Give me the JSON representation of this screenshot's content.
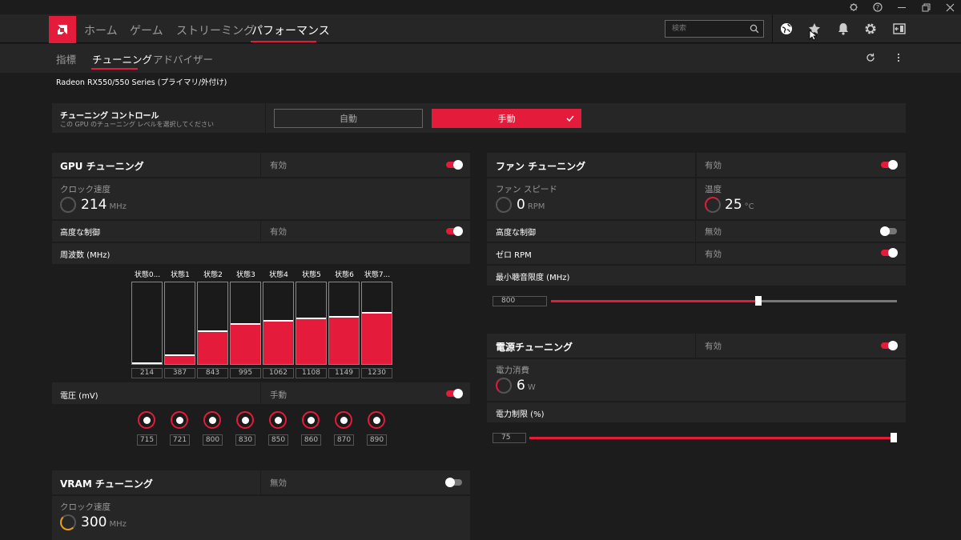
{
  "nav": {
    "items": [
      "ホーム",
      "ゲーム",
      "ストリーミング",
      "パフォーマンス"
    ],
    "active_index": 3
  },
  "search": {
    "placeholder": "検索"
  },
  "subnav": {
    "items": [
      "指標",
      "チューニング",
      "アドバイザー"
    ],
    "active_index": 1
  },
  "gpu_name": "Radeon RX550/550 Series (プライマリ/外付け)",
  "tuning_control": {
    "title": "チューニング コントロール",
    "subtitle": "この GPU のチューニング レベルを選択してください",
    "auto_label": "自動",
    "manual_label": "手動",
    "manual_selected": true
  },
  "gpu_tuning": {
    "title": "GPU チューニング",
    "status": "有効",
    "enabled": true,
    "clock": {
      "label": "クロック速度",
      "value": "214",
      "unit": "MHz"
    },
    "advanced": {
      "label": "高度な制御",
      "status": "有効",
      "enabled": true
    },
    "freq": {
      "label": "周波数 (MHz)",
      "states": [
        {
          "label": "状態0...",
          "value": "214",
          "fill": 0.02
        },
        {
          "label": "状態1",
          "value": "387",
          "fill": 0.12
        },
        {
          "label": "状態2",
          "value": "843",
          "fill": 0.41
        },
        {
          "label": "状態3",
          "value": "995",
          "fill": 0.5
        },
        {
          "label": "状態4",
          "value": "1062",
          "fill": 0.54
        },
        {
          "label": "状態5",
          "value": "1108",
          "fill": 0.57
        },
        {
          "label": "状態6",
          "value": "1149",
          "fill": 0.59
        },
        {
          "label": "状態7...",
          "value": "1230",
          "fill": 0.64
        }
      ]
    },
    "voltage": {
      "label": "電圧 (mV)",
      "status": "手動",
      "enabled": true,
      "values": [
        "715",
        "721",
        "800",
        "830",
        "850",
        "860",
        "870",
        "890"
      ]
    }
  },
  "vram_tuning": {
    "title": "VRAM チューニング",
    "status": "無効",
    "enabled": false,
    "clock": {
      "label": "クロック速度",
      "value": "300",
      "unit": "MHz"
    }
  },
  "fan_tuning": {
    "title": "ファン チューニング",
    "status": "有効",
    "enabled": true,
    "speed": {
      "label": "ファン スピード",
      "value": "0",
      "unit": "RPM"
    },
    "temp": {
      "label": "温度",
      "value": "25",
      "unit": "°C"
    },
    "advanced": {
      "label": "高度な制御",
      "status": "無効",
      "enabled": false
    },
    "zero_rpm": {
      "label": "ゼロ RPM",
      "status": "有効",
      "enabled": true
    },
    "min_acoustic": {
      "label": "最小聴音限度 (MHz)",
      "value": "800",
      "level": 0.6
    }
  },
  "power_tuning": {
    "title": "電源チューニング",
    "status": "有効",
    "enabled": true,
    "consumption": {
      "label": "電力消費",
      "value": "6",
      "unit": "W"
    },
    "limit": {
      "label": "電力制限 (%)",
      "value": "75",
      "level": 1.0
    }
  }
}
